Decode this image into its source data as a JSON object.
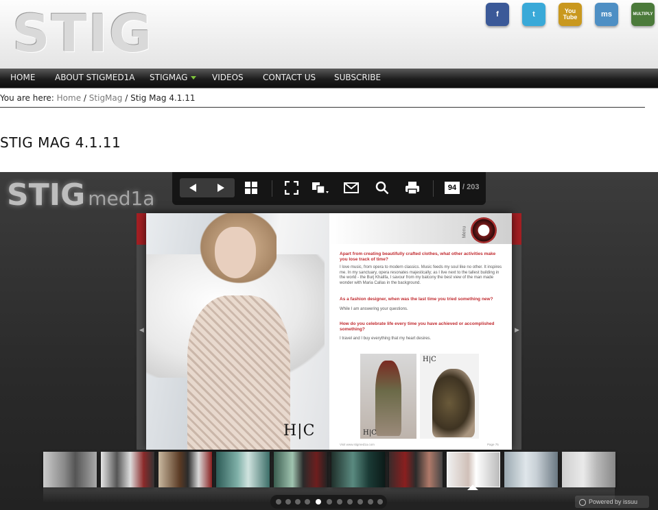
{
  "site": {
    "logo_text": "STIG"
  },
  "social": [
    {
      "name": "facebook-icon",
      "label": "f",
      "color": "#3b5998"
    },
    {
      "name": "twitter-icon",
      "label": "t",
      "color": "#39a9d8"
    },
    {
      "name": "youtube-icon",
      "label": "You Tube",
      "color": "#c9981e"
    },
    {
      "name": "myspace-icon",
      "label": "ms",
      "color": "#4e8fc4"
    },
    {
      "name": "multiply-icon",
      "label": "MULTIPLY",
      "color": "#4b7a3a"
    }
  ],
  "nav": {
    "items": [
      {
        "label": "HOME"
      },
      {
        "label": "ABOUT STIGMED1A"
      },
      {
        "label": "STIGMAG"
      },
      {
        "label": "VIDEOS"
      },
      {
        "label": "CONTACT US"
      },
      {
        "label": "SUBSCRIBE"
      }
    ]
  },
  "breadcrumb": {
    "prefix": "You are here:",
    "home": "Home",
    "sep": "/",
    "section": "StigMag",
    "current": "Stig Mag 4.1.11"
  },
  "page_title": "STIG MAG 4.1.11",
  "viewer": {
    "logo_main": "STIG",
    "logo_sub": "med1a",
    "current_page": "94",
    "total_pages": "/ 203",
    "powered_by": "Powered by issuu"
  },
  "magazine": {
    "menu_label": "Menu",
    "hc_mark": "H|C",
    "q1": "Apart from creating beautifully crafted clothes, what other activities make you lose track of time?",
    "a1": "I love music, from opera to modern classics. Music feeds my soul like no other. It inspires me. In my sanctuary, opera resonates majestically; as I live next to the tallest building in the world - the Burj Khalifa, I savour from my balcony the best view of the man made wonder with Maria Callas in the background.",
    "q2": "As a fashion designer, when was the last time you tried something new?",
    "a2": "While I am answering your questions.",
    "q3": "How do you celebrate life every time you have achieved or accomplished something?",
    "a3": "I travel and I buy everything that my heart desires.",
    "footer_left": "Visit www.stigmed1a.com",
    "footer_right": "Page 75"
  },
  "colors": {
    "accent_green": "#7ec43c",
    "magazine_red": "#c0282d",
    "nav_dark": "#1d1d1d"
  }
}
